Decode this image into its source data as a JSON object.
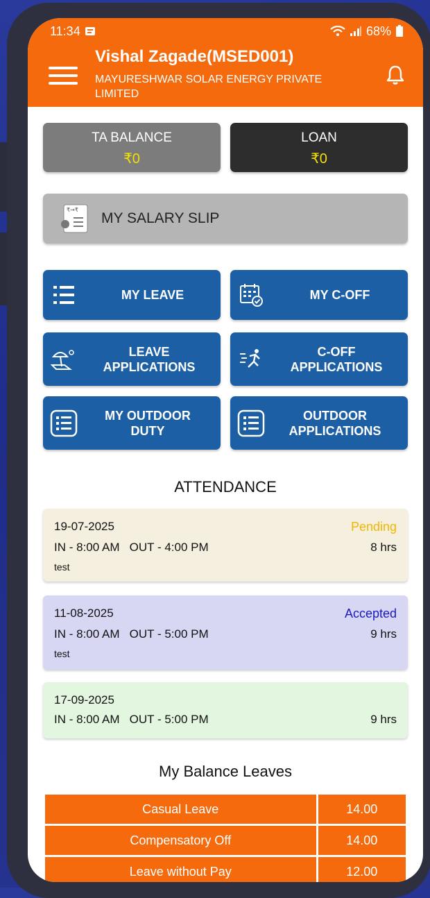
{
  "status_bar": {
    "time": "11:34",
    "battery": "68%"
  },
  "header": {
    "title": "Vishal Zagade(MSED001)",
    "company": "MAYURESHWAR SOLAR ENERGY PRIVATE LIMITED"
  },
  "balances": {
    "ta": {
      "label": "TA BALANCE",
      "value": "₹0"
    },
    "loan": {
      "label": "LOAN",
      "value": "₹0"
    }
  },
  "salary_slip": {
    "label": "MY SALARY SLIP"
  },
  "actions": {
    "my_leave": "MY LEAVE",
    "my_coff": "MY C-OFF",
    "leave_applications": "LEAVE APPLICATIONS",
    "coff_applications": "C-OFF APPLICATIONS",
    "my_outdoor_duty": "MY OUTDOOR DUTY",
    "outdoor_applications": "OUTDOOR APPLICATIONS"
  },
  "attendance": {
    "heading": "ATTENDANCE",
    "in_label": "IN",
    "out_label": "OUT",
    "records": [
      {
        "date": "19-07-2025",
        "status": "Pending",
        "in": "8:00 AM",
        "out": "4:00 PM",
        "hours": "8 hrs",
        "note": "test",
        "bg": "#f5efdf",
        "status_color": "#f2b600"
      },
      {
        "date": "11-08-2025",
        "status": "Accepted",
        "in": "8:00 AM",
        "out": "5:00 PM",
        "hours": "9 hrs",
        "note": "test",
        "bg": "#d8d7f3",
        "status_color": "#1a1ab8"
      },
      {
        "date": "17-09-2025",
        "status": "",
        "in": "8:00 AM",
        "out": "5:00 PM",
        "hours": "9 hrs",
        "note": "",
        "bg": "#e2f6e0",
        "status_color": "#000000"
      }
    ]
  },
  "balance_leaves": {
    "heading": "My Balance Leaves",
    "rows": [
      {
        "type": "Casual Leave",
        "value": "14.00"
      },
      {
        "type": "Compensatory Off",
        "value": "14.00"
      },
      {
        "type": "Leave without Pay",
        "value": "12.00"
      }
    ]
  },
  "colors": {
    "accent": "#f56a0c",
    "primary_blue": "#1d5fa5",
    "ta_card": "#7c7c7c",
    "loan_card": "#2d2d2d"
  }
}
